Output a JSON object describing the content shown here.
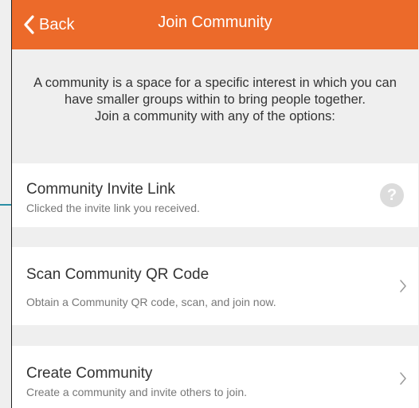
{
  "header": {
    "back_label": "Back",
    "title": "Join Community",
    "background_color": "#ec6a2a"
  },
  "intro": {
    "line1": "A community is a space for a specific interest in which you can have smaller groups within to bring people together.",
    "line2": "Join a community with any of the options:"
  },
  "options": [
    {
      "title": "Community Invite Link",
      "subtitle": "Clicked the invite link you received.",
      "accessory": "help-icon",
      "accessory_text": "?"
    },
    {
      "title": "Scan Community QR Code",
      "subtitle": "Obtain a Community QR code, scan, and join now.",
      "accessory": "chevron-right-icon"
    },
    {
      "title": "Create Community",
      "subtitle": "Create a community and invite others to join.",
      "accessory": "chevron-right-icon"
    }
  ]
}
